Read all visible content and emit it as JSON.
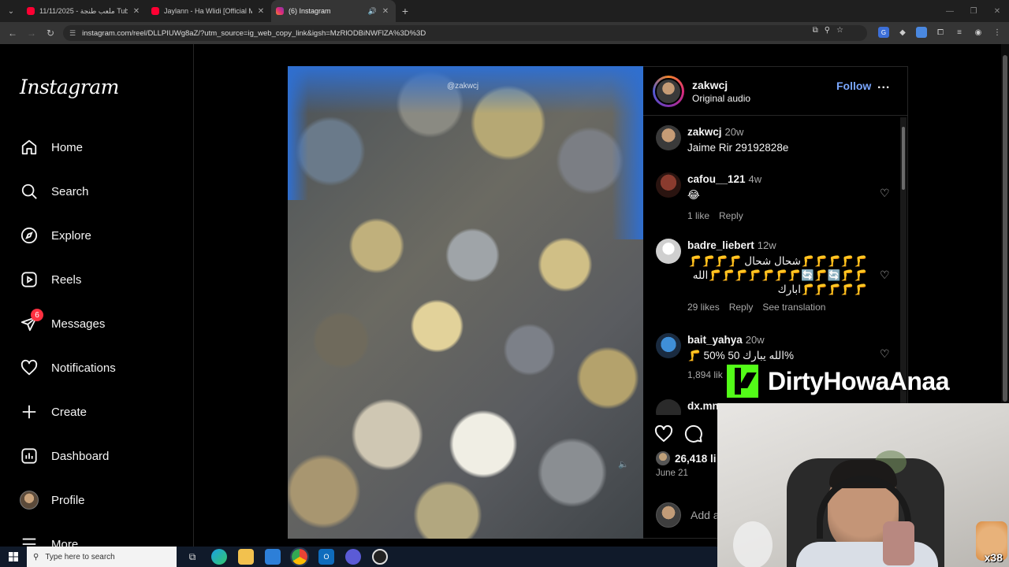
{
  "browser": {
    "tabs": [
      {
        "title": "ملعب طنجة - 11/11/2025 Tube",
        "color": "#ff0033",
        "active": false
      },
      {
        "title": "Jaylann - Ha Wlidi [Official Mu",
        "color": "#ff0033",
        "active": false
      },
      {
        "title": "(6) Instagram",
        "color": "#e1306c",
        "active": true
      }
    ],
    "url": "instagram.com/reel/DLLPIUWg8aZ/?utm_source=ig_web_copy_link&igsh=MzRlODBiNWFlZA%3D%3D"
  },
  "sidebar": {
    "logo": "Instagram",
    "items": [
      {
        "label": "Home",
        "icon": "home-icon"
      },
      {
        "label": "Search",
        "icon": "search-icon"
      },
      {
        "label": "Explore",
        "icon": "compass-icon"
      },
      {
        "label": "Reels",
        "icon": "reels-icon"
      },
      {
        "label": "Messages",
        "icon": "messenger-icon",
        "badge": "6"
      },
      {
        "label": "Notifications",
        "icon": "heart-icon"
      },
      {
        "label": "Create",
        "icon": "plus-icon"
      },
      {
        "label": "Dashboard",
        "icon": "dashboard-icon"
      },
      {
        "label": "Profile",
        "icon": "avatar"
      },
      {
        "label": "More",
        "icon": "menu-icon"
      }
    ]
  },
  "video": {
    "watermark": "@zakwcj"
  },
  "post": {
    "author": "zakwcj",
    "audio": "Original audio",
    "follow_label": "Follow",
    "more_label": "...",
    "caption": {
      "user": "zakwcj",
      "time": "20w",
      "text": "Jaime Rir 29192828e"
    },
    "comments": [
      {
        "user": "cafou__121",
        "time": "4w",
        "text": "😂",
        "likes": "1 like",
        "reply": "Reply",
        "translate": ""
      },
      {
        "user": "badre_liebert",
        "time": "12w",
        "text": "🦵🦵🦵🦵🦵شحال شحال 🦵🦵🦵🦵🦵🦵🔄🦵🔄🦵🦵🦵🦵🦵🦵🦵الله🦵🦵🦵🦵🦵ابارك",
        "likes": "29 likes",
        "reply": "Reply",
        "translate": "See translation"
      },
      {
        "user": "bait_yahya",
        "time": "20w",
        "text": "🦵 50% الله يبارك 50%",
        "likes": "1,894 lik",
        "reply": "",
        "translate": ""
      },
      {
        "user": "dx.mn",
        "time": "",
        "text": "",
        "likes": "",
        "reply": "",
        "translate": ""
      }
    ],
    "likes_count": "26,418 li",
    "date": "June 21",
    "add_comment_placeholder": "Add a"
  },
  "overlay": {
    "name": "DirtyHowaAnaa",
    "brand_color": "#53fc18",
    "counter": "x38"
  },
  "taskbar": {
    "search_placeholder": "Type here to search"
  }
}
